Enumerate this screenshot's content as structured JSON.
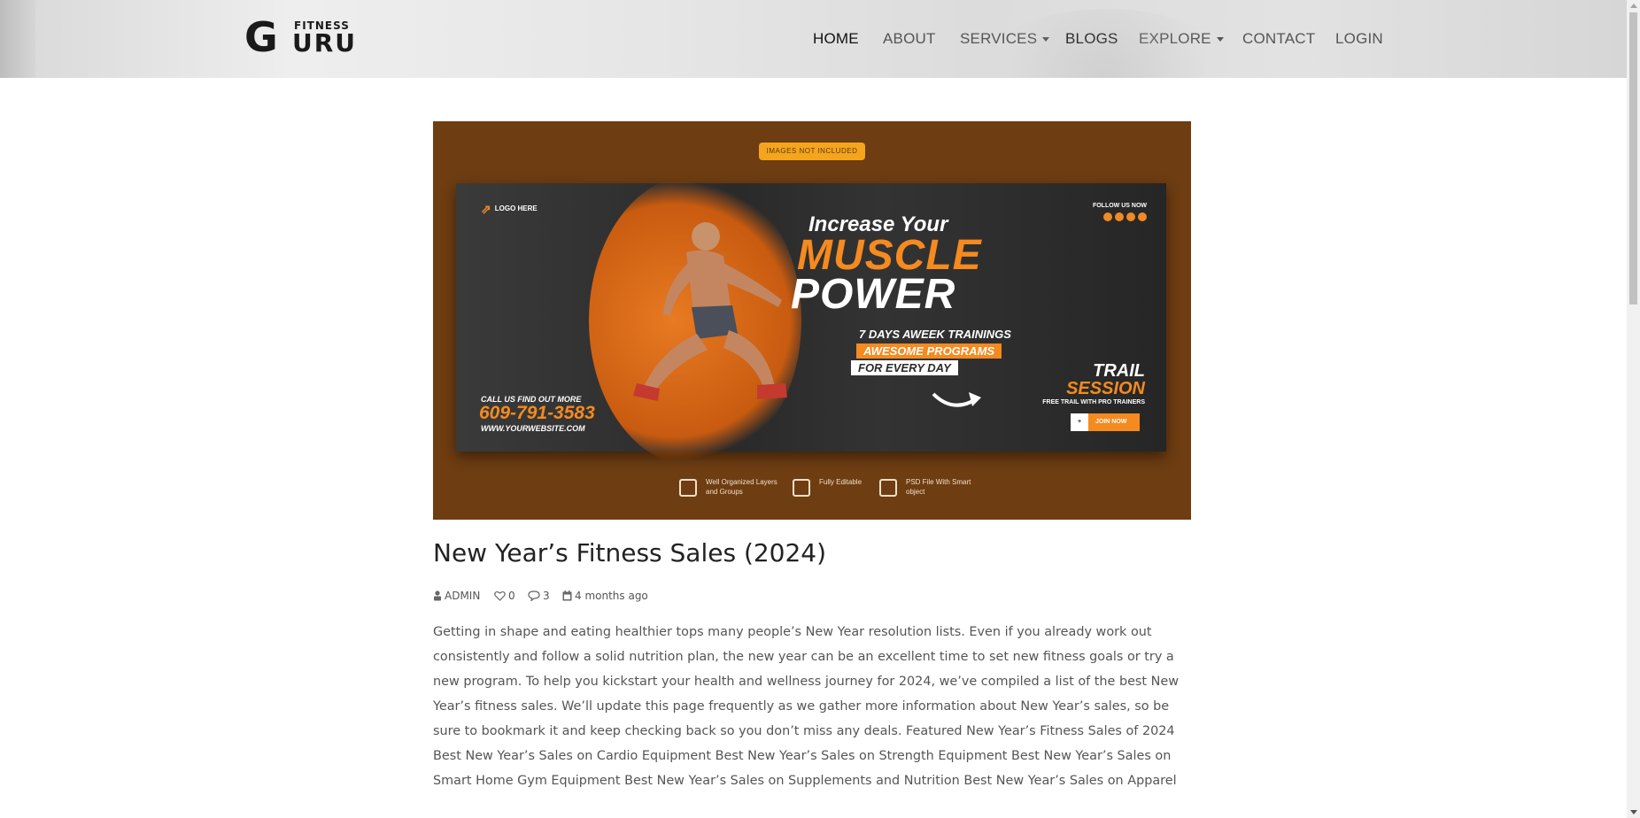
{
  "brand": {
    "logo_letter": "G",
    "logo_top": "FITNESS",
    "logo_bottom": "URU"
  },
  "nav": {
    "items": [
      {
        "label": "HOME",
        "active": true,
        "dropdown": false
      },
      {
        "label": "ABOUT",
        "active": false,
        "dropdown": false
      },
      {
        "label": "SERVICES",
        "active": false,
        "dropdown": true
      },
      {
        "label": "BLOGS",
        "active": true,
        "dropdown": false
      },
      {
        "label": "EXPLORE",
        "active": false,
        "dropdown": true
      },
      {
        "label": "CONTACT",
        "active": false,
        "dropdown": false
      },
      {
        "label": "LOGIN",
        "active": false,
        "dropdown": false
      }
    ]
  },
  "hero": {
    "badge": "IMAGES NOT INCLUDED",
    "logo_here": "LOGO HERE",
    "follow": "FOLLOW US NOW",
    "line1": "Increase Your",
    "line2": "MUSCLE",
    "line3": "POWER",
    "line4": "7 DAYS AWEEK TRAININGS",
    "line5": "AWESOME PROGRAMS",
    "line6": "FOR EVERY DAY",
    "trail1": "TRAIL",
    "trail2": "SESSION",
    "trail3": "FREE TRAIL WITH PRO TRAINERS",
    "join": "JOIN NOW",
    "call": "CALL US FIND OUT MORE",
    "phone": "609-791-3583",
    "site": "WWW.YOURWEBSITE.COM",
    "features": [
      "Well Organized Layers and Groups",
      "Fully Editable",
      "PSD File With Smart object"
    ]
  },
  "post": {
    "title": "New Year’s Fitness Sales (2024)",
    "author": "ADMIN",
    "likes": "0",
    "comments": "3",
    "date": "4 months ago",
    "body": "Getting in shape and eating healthier tops many people’s New Year resolution lists. Even if you already work out consistently and follow a solid nutrition plan, the new year can be an excellent time to set new fitness goals or try a new program. To help you kickstart your health and wellness journey for 2024, we’ve compiled a list of the best New Year’s fitness sales. We’ll update this page frequently as we gather more information about New Year’s sales, so be sure to bookmark it and keep checking back so you don’t miss any deals. Featured New Year’s Fitness Sales of 2024 Best New Year’s Sales on Cardio Equipment Best New Year’s Sales on Strength Equipment Best New Year’s Sales on Smart Home Gym Equipment Best New Year’s Sales on Supplements and Nutrition Best New Year’s Sales on Apparel"
  },
  "colors": {
    "accent_orange": "#f58a1f",
    "hero_background": "#6e3d12",
    "nav_active": "#111111",
    "nav_text": "#555555"
  },
  "icons": {
    "author": "user-icon",
    "likes": "heart-icon",
    "comments": "comment-icon",
    "date": "calendar-icon"
  }
}
